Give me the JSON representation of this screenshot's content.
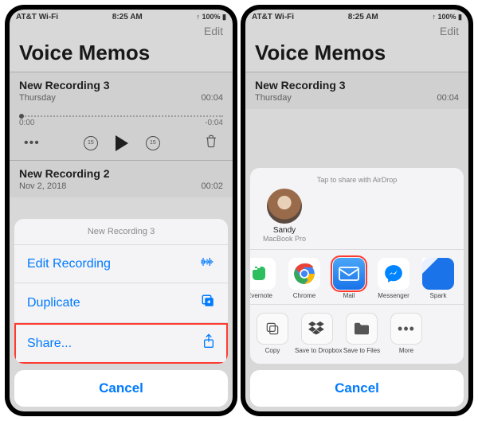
{
  "statusbar": {
    "carrier": "AT&T Wi-Fi",
    "time": "8:25 AM",
    "battery": "100%"
  },
  "app": {
    "title": "Voice Memos",
    "edit": "Edit"
  },
  "recordings": [
    {
      "name": "New Recording 3",
      "subtitle": "Thursday",
      "duration": "00:04"
    },
    {
      "name": "New Recording 2",
      "subtitle": "Nov 2, 2018",
      "duration": "00:02"
    }
  ],
  "scrubber": {
    "start": "0:00",
    "end": "-0:04"
  },
  "skip": {
    "back": "15",
    "fwd": "15"
  },
  "action_sheet": {
    "title": "New Recording 3",
    "items": [
      {
        "label": "Edit Recording",
        "icon": "waveform-icon"
      },
      {
        "label": "Duplicate",
        "icon": "duplicate-icon"
      },
      {
        "label": "Share...",
        "icon": "share-icon"
      }
    ],
    "cancel": "Cancel"
  },
  "share_sheet": {
    "airdrop_hint": "Tap to share with AirDrop",
    "airdrop_contact": {
      "name": "Sandy",
      "device": "MacBook Pro"
    },
    "apps": [
      {
        "label": "Evernote",
        "key": "evernote"
      },
      {
        "label": "Chrome",
        "key": "chrome"
      },
      {
        "label": "Mail",
        "key": "mail"
      },
      {
        "label": "Messenger",
        "key": "messenger"
      },
      {
        "label": "Spark",
        "key": "spark"
      }
    ],
    "actions": [
      {
        "label": "Copy",
        "key": "copy"
      },
      {
        "label": "Save to Dropbox",
        "key": "dropbox"
      },
      {
        "label": "Save to Files",
        "key": "files"
      },
      {
        "label": "More",
        "key": "more"
      }
    ],
    "cancel": "Cancel"
  }
}
